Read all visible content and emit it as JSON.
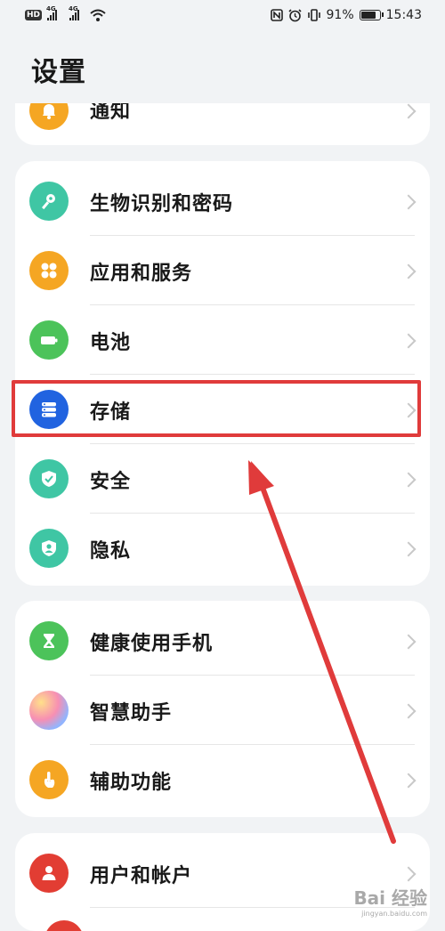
{
  "status_bar": {
    "hd": "HD",
    "net1": "4G",
    "net2": "4G",
    "battery_percent": "91%",
    "battery_level": 0.91,
    "time": "15:43"
  },
  "page": {
    "title": "设置"
  },
  "groups": [
    {
      "items": [
        {
          "label": "通知",
          "icon": "bell-icon",
          "color": "#f5a623"
        }
      ]
    },
    {
      "items": [
        {
          "label": "生物识别和密码",
          "icon": "key-icon",
          "color": "#3fc6a4"
        },
        {
          "label": "应用和服务",
          "icon": "apps-icon",
          "color": "#f5a623"
        },
        {
          "label": "电池",
          "icon": "battery-icon",
          "color": "#4cc35a"
        },
        {
          "label": "存储",
          "icon": "storage-icon",
          "color": "#2163e0"
        },
        {
          "label": "安全",
          "icon": "shield-icon",
          "color": "#3fc6a4"
        },
        {
          "label": "隐私",
          "icon": "privacy-icon",
          "color": "#3fc6a4"
        }
      ]
    },
    {
      "items": [
        {
          "label": "健康使用手机",
          "icon": "hourglass-icon",
          "color": "#4cc35a"
        },
        {
          "label": "智慧助手",
          "icon": "assistant-icon",
          "color": "#b68cf0"
        },
        {
          "label": "辅助功能",
          "icon": "hand-icon",
          "color": "#f5a623"
        }
      ]
    },
    {
      "items": [
        {
          "label": "用户和帐户",
          "icon": "user-icon",
          "color": "#e23d33"
        }
      ]
    }
  ],
  "annotation": {
    "highlight_color": "#e03b3b"
  },
  "watermark": {
    "text": "Bai 经验",
    "sub": "jingyan.baidu.com"
  }
}
